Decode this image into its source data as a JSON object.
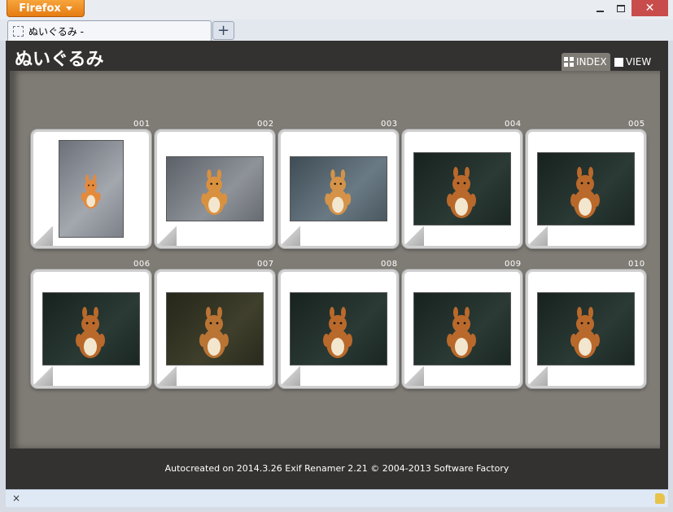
{
  "browser": {
    "menu_button_label": "Firefox",
    "tab_title": "ぬいぐるみ -",
    "new_tab_label": "+",
    "close_glyph": "✕",
    "status_close_glyph": "×"
  },
  "page": {
    "title": "ぬいぐるみ",
    "nav": {
      "index_label": "INDEX",
      "view_label": "VIEW"
    },
    "footer": "Autocreated on 2014.3.26  Exif Renamer 2.21 © 2004-2013 Software Factory"
  },
  "gallery": {
    "items": [
      {
        "number": "001",
        "photo": "teddy-portrait-gray"
      },
      {
        "number": "002",
        "photo": "teddy-landscape-gray"
      },
      {
        "number": "003",
        "photo": "teddy-landscape-blue"
      },
      {
        "number": "004",
        "photo": "teddy-landscape-dark"
      },
      {
        "number": "005",
        "photo": "teddy-landscape-dark"
      },
      {
        "number": "006",
        "photo": "teddy-landscape-dark"
      },
      {
        "number": "007",
        "photo": "teddy-landscape-olive"
      },
      {
        "number": "008",
        "photo": "teddy-landscape-dark"
      },
      {
        "number": "009",
        "photo": "teddy-landscape-dark"
      },
      {
        "number": "010",
        "photo": "teddy-landscape-dark"
      }
    ]
  },
  "colors": {
    "firefox_orange": "#e8861a",
    "page_bg": "#333230",
    "gallery_bg": "#7f7b75",
    "close_red": "#c94c4c"
  }
}
